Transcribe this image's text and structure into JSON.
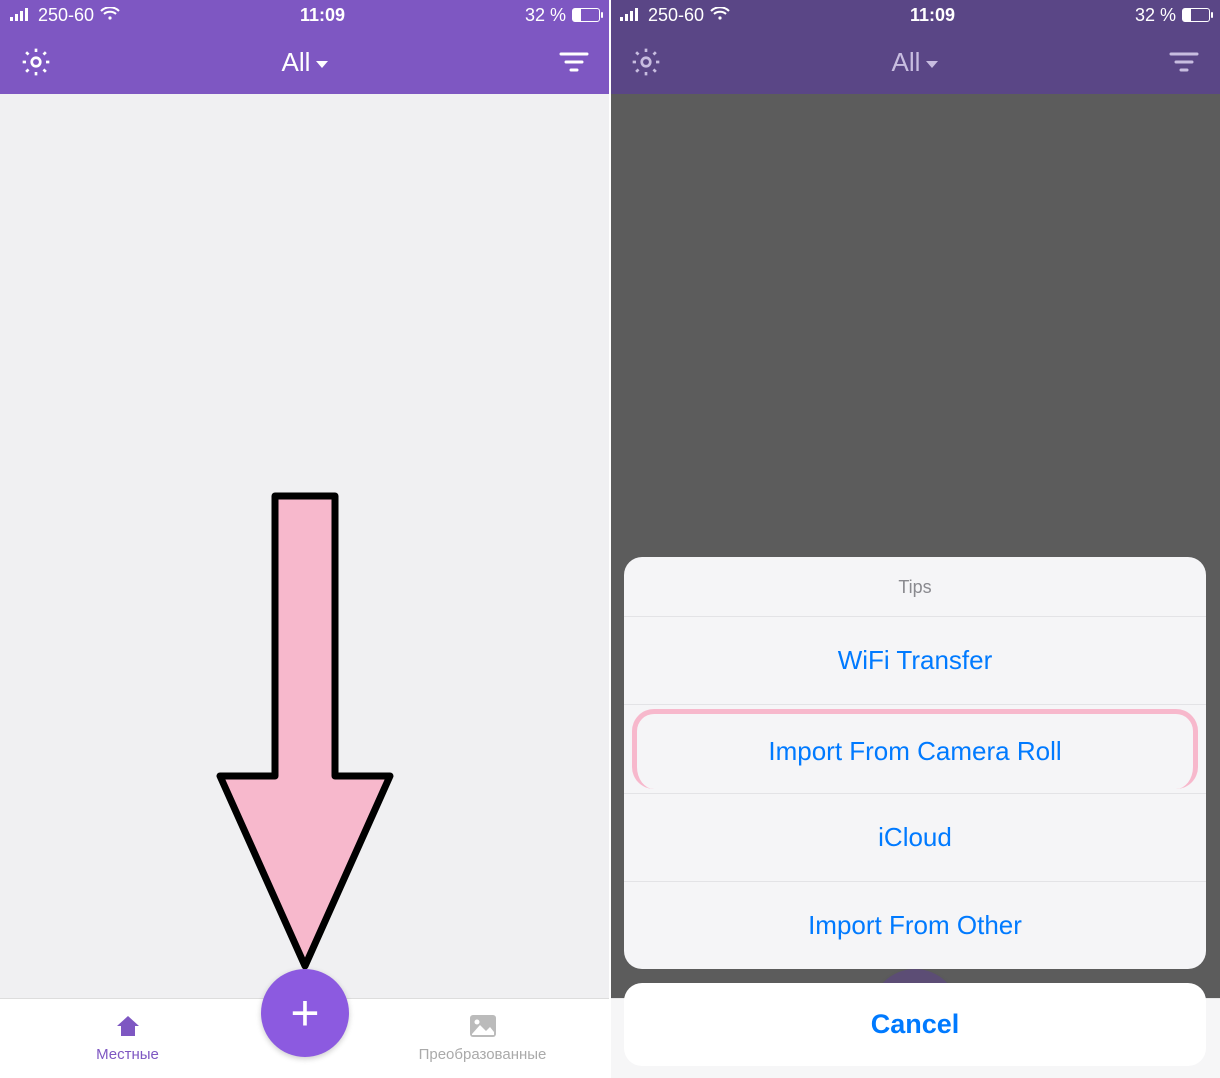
{
  "status": {
    "carrier": "250-60",
    "time": "11:09",
    "battery": "32 %"
  },
  "nav": {
    "title": "All"
  },
  "tabs": {
    "left": "Местные",
    "right": "Преобразованные"
  },
  "sheet": {
    "title": "Tips",
    "items": [
      "WiFi Transfer",
      "Import From Camera Roll",
      "iCloud",
      "Import From Other"
    ],
    "cancel": "Cancel"
  }
}
